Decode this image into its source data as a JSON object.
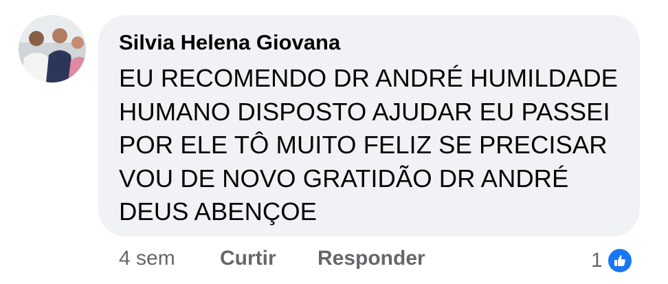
{
  "comment": {
    "author": "Silvia Helena Giovana",
    "text_lines": [
      "EU RECOMENDO DR ANDRÉ HUMILDADE",
      "HUMANO DISPOSTO AJUDAR EU PASSEI",
      "POR ELE TÔ MUITO FELIZ SE PRECISAR",
      "VOU DE NOVO GRATIDÃO DR ANDRÉ",
      "DEUS ABENÇOE"
    ]
  },
  "actions": {
    "time": "4 sem",
    "like_label": "Curtir",
    "reply_label": "Responder",
    "reaction_count": "1",
    "reaction_icon": "like-thumbs-up-icon"
  },
  "colors": {
    "bubble": "#f0f2f5",
    "text": "#050505",
    "secondary": "#65676b",
    "like_blue": "#1877f2"
  }
}
